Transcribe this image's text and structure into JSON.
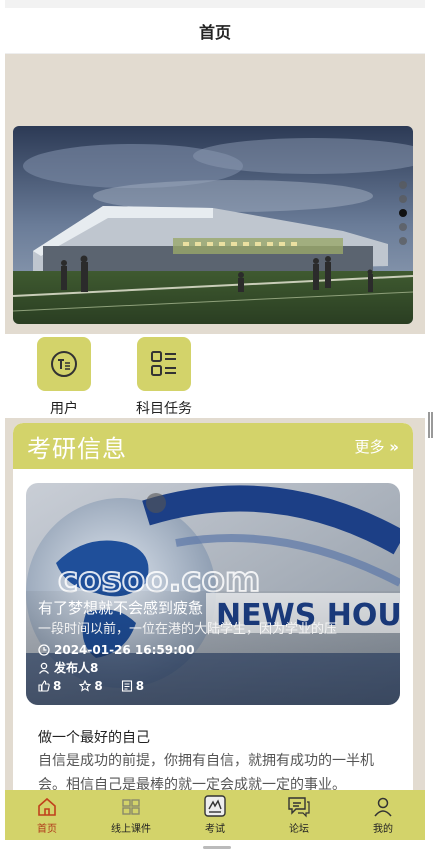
{
  "navbar": {
    "title": "首页"
  },
  "quick": [
    {
      "label": "用户",
      "icon": "user-text-icon"
    },
    {
      "label": "科目任务",
      "icon": "task-list-icon"
    }
  ],
  "panel": {
    "title": "考研信息",
    "more": "更多"
  },
  "news": {
    "title": "有了梦想就不会感到疲惫",
    "desc": "一段时间以前，一位在港的大陆学生，因为学业的压",
    "time": "2024-01-26 16:59:00",
    "author": "发布人8",
    "likes": "8",
    "favorites": "8",
    "views": "8",
    "watermark": "cosoo.com"
  },
  "text_block": {
    "title": "做一个最好的自己",
    "body": "自信是成功的前提，你拥有自信，就拥有成功的一半机会。相信自己是最棒的就一定会成就一定的事业。"
  },
  "tabs": [
    {
      "label": "首页",
      "icon": "home-icon",
      "active": true
    },
    {
      "label": "线上课件",
      "icon": "courseware-icon",
      "active": false
    },
    {
      "label": "考试",
      "icon": "exam-icon",
      "active": false
    },
    {
      "label": "论坛",
      "icon": "forum-icon",
      "active": false
    },
    {
      "label": "我的",
      "icon": "person-icon",
      "active": false
    }
  ],
  "colors": {
    "accent": "#d3d36a",
    "active_tab": "#b03a1a",
    "page_bg": "#e2dbd0"
  }
}
